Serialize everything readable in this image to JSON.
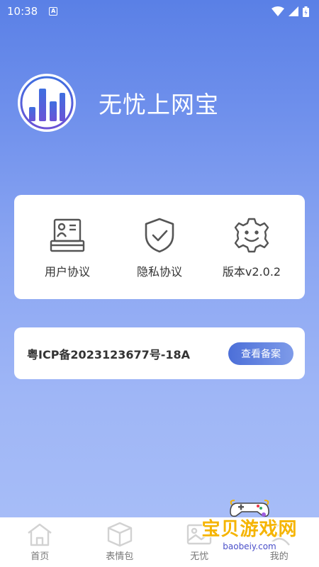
{
  "status_bar": {
    "time": "10:38",
    "notification": "A"
  },
  "app": {
    "name": "无忧上网宝"
  },
  "links": [
    {
      "label": "用户协议",
      "icon": "id-card-icon"
    },
    {
      "label": "隐私协议",
      "icon": "shield-check-icon"
    },
    {
      "label": "版本v2.0.2",
      "icon": "gear-smile-icon"
    }
  ],
  "icp": {
    "number": "粤ICP备2023123677号-18A",
    "button_label": "查看备案"
  },
  "tabs": [
    {
      "label": "首页",
      "icon": "home-icon"
    },
    {
      "label": "表情包",
      "icon": "box-icon"
    },
    {
      "label": "无忧",
      "icon": "image-icon"
    },
    {
      "label": "我的",
      "icon": "user-icon"
    }
  ],
  "watermark": {
    "text": "宝贝游戏网",
    "url": "baobeiy.com"
  },
  "colors": {
    "accent": "#4c6fd8",
    "background_top": "#5a80e6",
    "background_bottom": "#a9bff8",
    "icon_gray": "#555555"
  }
}
